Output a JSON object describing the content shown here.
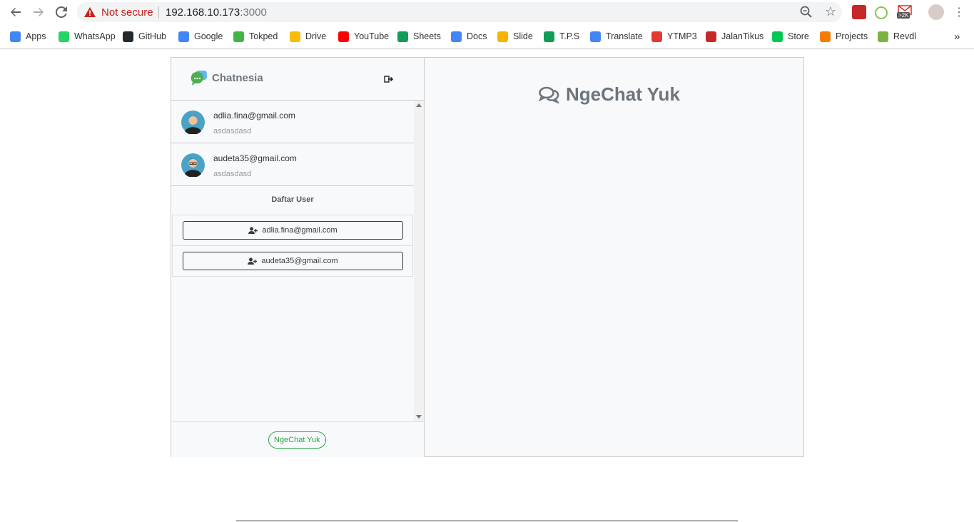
{
  "browser": {
    "security_label": "Not secure",
    "url_host": "192.168.10.173",
    "url_port": ":3000",
    "badge_count": ">2K"
  },
  "bookmarks": [
    {
      "label": "Apps",
      "icon": "apps-grid-icon",
      "color": "#4285f4"
    },
    {
      "label": "WhatsApp",
      "icon": "whatsapp-icon",
      "color": "#25d366"
    },
    {
      "label": "GitHub",
      "icon": "github-icon",
      "color": "#24292e"
    },
    {
      "label": "Google",
      "icon": "google-icon",
      "color": "#4285f4"
    },
    {
      "label": "Tokped",
      "icon": "tokopedia-icon",
      "color": "#42b549"
    },
    {
      "label": "Drive",
      "icon": "drive-icon",
      "color": "#fbbc05"
    },
    {
      "label": "YouTube",
      "icon": "youtube-icon",
      "color": "#ff0000"
    },
    {
      "label": "Sheets",
      "icon": "sheets-icon",
      "color": "#0f9d58"
    },
    {
      "label": "Docs",
      "icon": "docs-icon",
      "color": "#4285f4"
    },
    {
      "label": "Slide",
      "icon": "slides-icon",
      "color": "#f4b400"
    },
    {
      "label": "T.P.S",
      "icon": "tps-icon",
      "color": "#0f9d58"
    },
    {
      "label": "Translate",
      "icon": "google-icon",
      "color": "#4285f4"
    },
    {
      "label": "YTMP3",
      "icon": "download-icon",
      "color": "#e53935"
    },
    {
      "label": "JalanTikus",
      "icon": "jalantikus-icon",
      "color": "#c62828"
    },
    {
      "label": "Store",
      "icon": "play-store-icon",
      "color": "#00c853"
    },
    {
      "label": "Projects",
      "icon": "projects-icon",
      "color": "#f57c00"
    },
    {
      "label": "Revdl",
      "icon": "revdl-icon",
      "color": "#7cb342"
    }
  ],
  "app": {
    "brand_name": "Chatnesia",
    "chats": [
      {
        "email": "adlia.fina@gmail.com",
        "last_message": "asdasdasd"
      },
      {
        "email": "audeta35@gmail.com",
        "last_message": "asdasdasd"
      }
    ],
    "user_section_title": "Daftar User",
    "users": [
      {
        "email": "adlia.fina@gmail.com"
      },
      {
        "email": "audeta35@gmail.com"
      }
    ],
    "footer_button": "NgeChat Yuk",
    "main_title": "NgeChat Yuk"
  }
}
